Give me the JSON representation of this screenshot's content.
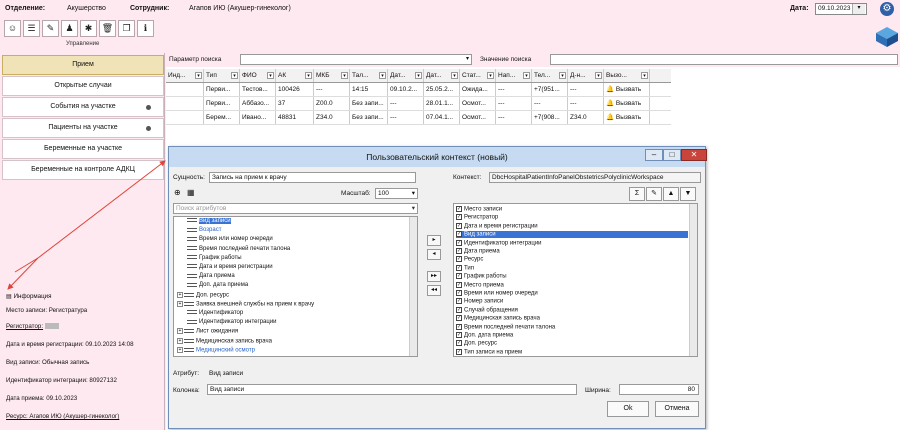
{
  "header": {
    "department_label": "Отделение:",
    "department_value": "Акушерство",
    "employee_label": "Сотрудник:",
    "employee_value": "Агапов ИЮ (Акушер-гинеколог)",
    "date_label": "Дата:",
    "date_value": "09.10.2023"
  },
  "toolbar": {
    "caption": "Управление",
    "icons": [
      "users-icon",
      "list-icon",
      "edit-list-icon",
      "user-group-icon",
      "bug-icon",
      "trash-icon",
      "copy-icon",
      "info-icon"
    ]
  },
  "sidebar": {
    "items": [
      {
        "label": "Прием"
      },
      {
        "label": "Открытые случаи"
      },
      {
        "label": "События на участке"
      },
      {
        "label": "Пациенты на участке"
      },
      {
        "label": "Беременные на участке"
      },
      {
        "label": "Беременные на контроле АДКЦ"
      }
    ]
  },
  "info": {
    "title": "Информация",
    "place": "Место записи: Регистратура",
    "registrar": "Регистратор:",
    "reg_datetime": "Дата и время регистрации: 09.10.2023 14:08",
    "record_type": "Вид записи: Обычная запись",
    "integration_id": "Идентификатор интеграции: 80927132",
    "appointment_date": "Дата приема: 09.10.2023",
    "resource": "Ресурс: Агапов ИЮ (Акушер-гинеколог)"
  },
  "search": {
    "param_label": "Параметр поиска",
    "value_label": "Значение поиска"
  },
  "grid": {
    "headers": [
      "Инд...",
      "Тип",
      "ФИО",
      "АК",
      "МКБ",
      "Тал...",
      "Дат...",
      "Дат...",
      "Стат...",
      "Нап...",
      "Тел...",
      "Д-н...",
      "Вызо..."
    ],
    "rows": [
      [
        "",
        "Перви...",
        "Тестов...",
        "100426",
        "---",
        "14:15",
        "09.10.2...",
        "25.05.2...",
        "Ожида...",
        "---",
        "+7(951...",
        "---",
        "Вызвать"
      ],
      [
        "",
        "Перви...",
        "Аббазо...",
        "37",
        "Z00.0",
        "Без запи...",
        "---",
        "28.01.1...",
        "Осмот...",
        "---",
        "---",
        "---",
        "Вызвать"
      ],
      [
        "",
        "Берем...",
        "Ивано...",
        "48831",
        "Z34.0",
        "Без запи...",
        "---",
        "07.04.1...",
        "Осмот...",
        "---",
        "+7(908...",
        "Z34.0",
        "Вызвать"
      ]
    ]
  },
  "dialog": {
    "title": "Пользовательский контекст (новый)",
    "entity_label": "Сущность:",
    "entity_value": "Запись на прием к врачу",
    "scale_label": "Масштаб:",
    "scale_value": "100",
    "search_placeholder": "Поиск атрибутов",
    "context_label": "Контекст:",
    "context_value": "DbcHospitalPatientInfoPanelObstetricsPolyclinicWorkspace",
    "tree": [
      {
        "label": "Вид записи",
        "style": "sel"
      },
      {
        "label": "Возраст",
        "style": "blue"
      },
      {
        "label": "Время или номер очереди",
        "style": ""
      },
      {
        "label": "Время последней печати талона",
        "style": ""
      },
      {
        "label": "График работы",
        "style": ""
      },
      {
        "label": "Дата и время регистрации",
        "style": ""
      },
      {
        "label": "Дата приема",
        "style": ""
      },
      {
        "label": "Доп. дата приема",
        "style": ""
      },
      {
        "label": "Доп. ресурс",
        "style": "plus"
      },
      {
        "label": "Заявка внешней службы на прием к врачу",
        "style": "plus"
      },
      {
        "label": "Идентификатор",
        "style": ""
      },
      {
        "label": "Идентификатор интеграции",
        "style": ""
      },
      {
        "label": "Лист ожидания",
        "style": "plus"
      },
      {
        "label": "Медицинская запись врача",
        "style": "plus"
      },
      {
        "label": "Медицинский осмотр",
        "style": "plusblue"
      }
    ],
    "checked": [
      {
        "label": "Место записи",
        "sel": false
      },
      {
        "label": "Регистратор",
        "sel": false
      },
      {
        "label": "Дата и время регистрации",
        "sel": false
      },
      {
        "label": "Вид записи",
        "sel": true
      },
      {
        "label": "Идентификатор интеграции",
        "sel": false
      },
      {
        "label": "Дата приема",
        "sel": false
      },
      {
        "label": "Ресурс",
        "sel": false
      },
      {
        "label": "Тип",
        "sel": false
      },
      {
        "label": "График работы",
        "sel": false
      },
      {
        "label": "Место приема",
        "sel": false
      },
      {
        "label": "Время или номер очереди",
        "sel": false
      },
      {
        "label": "Номер записи",
        "sel": false
      },
      {
        "label": "Случай обращения",
        "sel": false
      },
      {
        "label": "Медицинская запись врача",
        "sel": false
      },
      {
        "label": "Время последней печати талона",
        "sel": false
      },
      {
        "label": "Доп. дата приема",
        "sel": false
      },
      {
        "label": "Доп. ресурс",
        "sel": false
      },
      {
        "label": "Тип записи на прием",
        "sel": false
      }
    ],
    "attribute_label": "Атрибут:",
    "attribute_value": "Вид записи",
    "column_label": "Колонка:",
    "column_value": "Вид записи",
    "width_label": "Ширина:",
    "width_value": "80",
    "ok_label": "Ok",
    "cancel_label": "Отмена"
  },
  "colors": {
    "accent": "#3a73d6",
    "annotation_arrow": "#e0443a",
    "title_bar": "#c6dbf2"
  }
}
